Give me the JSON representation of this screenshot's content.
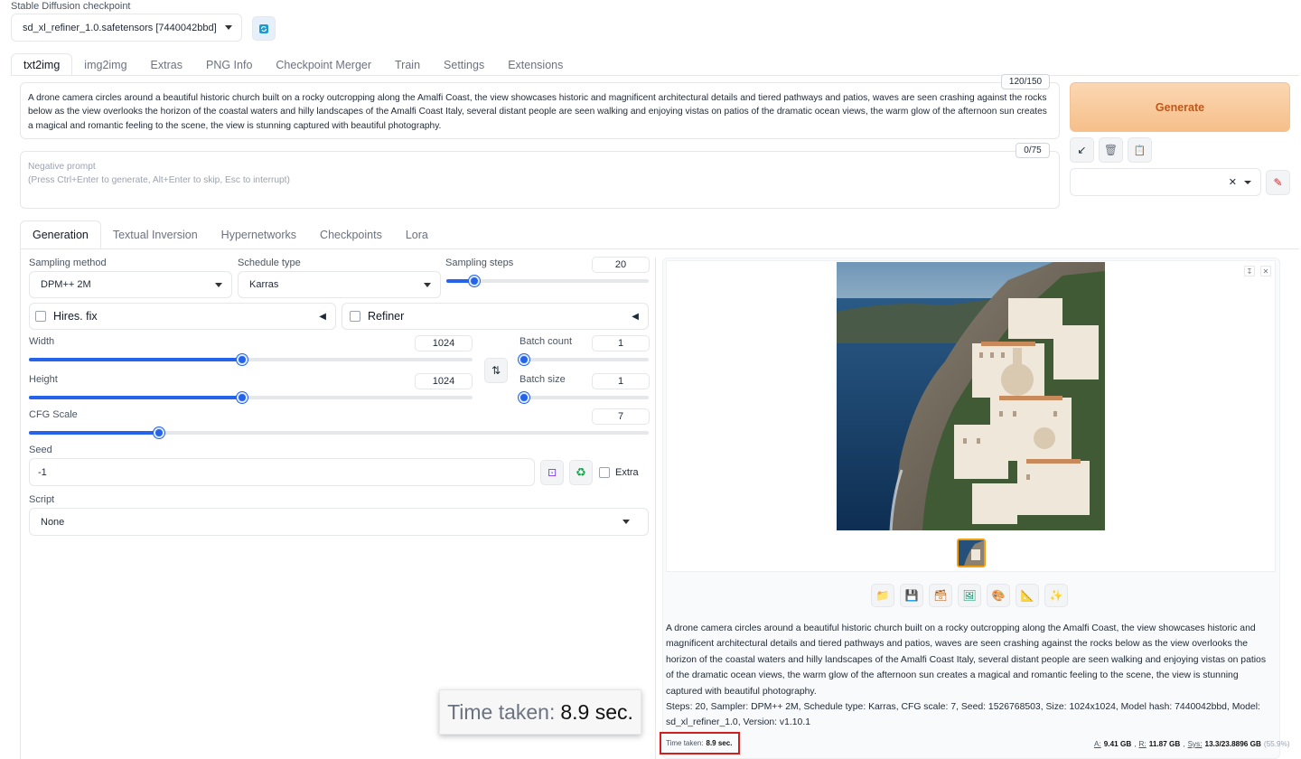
{
  "checkpoint": {
    "label": "Stable Diffusion checkpoint",
    "value": "sd_xl_refiner_1.0.safetensors [7440042bbd]",
    "refresh_icon": "refresh-icon"
  },
  "main_tabs": [
    "txt2img",
    "img2img",
    "Extras",
    "PNG Info",
    "Checkpoint Merger",
    "Train",
    "Settings",
    "Extensions"
  ],
  "prompt": {
    "text": "A drone camera circles around a beautiful historic church built on a rocky outcropping along the Amalfi Coast, the view showcases historic and magnificent architectural details and tiered pathways and patios, waves are seen crashing against the rocks below as the view overlooks the horizon of the coastal waters and hilly landscapes of the Amalfi Coast Italy, several distant people are seen walking and enjoying vistas on patios of the dramatic ocean views, the warm glow of the afternoon sun creates a magical and romantic feeling to the scene, the view is stunning captured with beautiful photography.",
    "token_count": "120/150"
  },
  "negative_prompt": {
    "placeholder_line1": "Negative prompt",
    "placeholder_line2": "(Press Ctrl+Enter to generate, Alt+Enter to skip, Esc to interrupt)",
    "token_count": "0/75"
  },
  "generate_label": "Generate",
  "sub_tabs": [
    "Generation",
    "Textual Inversion",
    "Hypernetworks",
    "Checkpoints",
    "Lora"
  ],
  "sampling_method": {
    "label": "Sampling method",
    "value": "DPM++ 2M"
  },
  "schedule_type": {
    "label": "Schedule type",
    "value": "Karras"
  },
  "sampling_steps": {
    "label": "Sampling steps",
    "value": "20",
    "fraction": 0.14
  },
  "hires_fix": {
    "label": "Hires. fix"
  },
  "refiner": {
    "label": "Refiner"
  },
  "width": {
    "label": "Width",
    "value": "1024",
    "fraction": 0.48
  },
  "height": {
    "label": "Height",
    "value": "1024",
    "fraction": 0.48
  },
  "batch_count": {
    "label": "Batch count",
    "value": "1",
    "fraction": 0.0
  },
  "batch_size": {
    "label": "Batch size",
    "value": "1",
    "fraction": 0.0
  },
  "cfg_scale": {
    "label": "CFG Scale",
    "value": "7",
    "fraction": 0.21
  },
  "seed": {
    "label": "Seed",
    "value": "-1",
    "extra_label": "Extra"
  },
  "script": {
    "label": "Script",
    "value": "None"
  },
  "output": {
    "info_text": "A drone camera circles around a beautiful historic church built on a rocky outcropping along the Amalfi Coast, the view showcases historic and magnificent architectural details and tiered pathways and patios, waves are seen crashing against the rocks below as the view overlooks the horizon of the coastal waters and hilly landscapes of the Amalfi Coast Italy, several distant people are seen walking and enjoying vistas on patios of the dramatic ocean views, the warm glow of the afternoon sun creates a magical and romantic feeling to the scene, the view is stunning captured with beautiful photography.",
    "params_text": "Steps: 20, Sampler: DPM++ 2M, Schedule type: Karras, CFG scale: 7, Seed: 1526768503, Size: 1024x1024, Model hash: 7440042bbd, Model: sd_xl_refiner_1.0, Version: v1.10.1",
    "time_label": "Time taken:",
    "time_value": "8.9 sec.",
    "vram_a_label": "A:",
    "vram_a": "9.41 GB",
    "vram_r_label": "R:",
    "vram_r": "11.87 GB",
    "vram_sys_label": "Sys:",
    "vram_sys": "13.3/23.8896 GB",
    "vram_pct": "(55.9%)"
  },
  "callout": {
    "label": "Time taken:",
    "value": "8.9 sec."
  },
  "colors": {
    "accent": "#2563eb",
    "generate_bg": "#f8c99a",
    "generate_text": "#c2571a",
    "highlight": "#d11f1f"
  }
}
